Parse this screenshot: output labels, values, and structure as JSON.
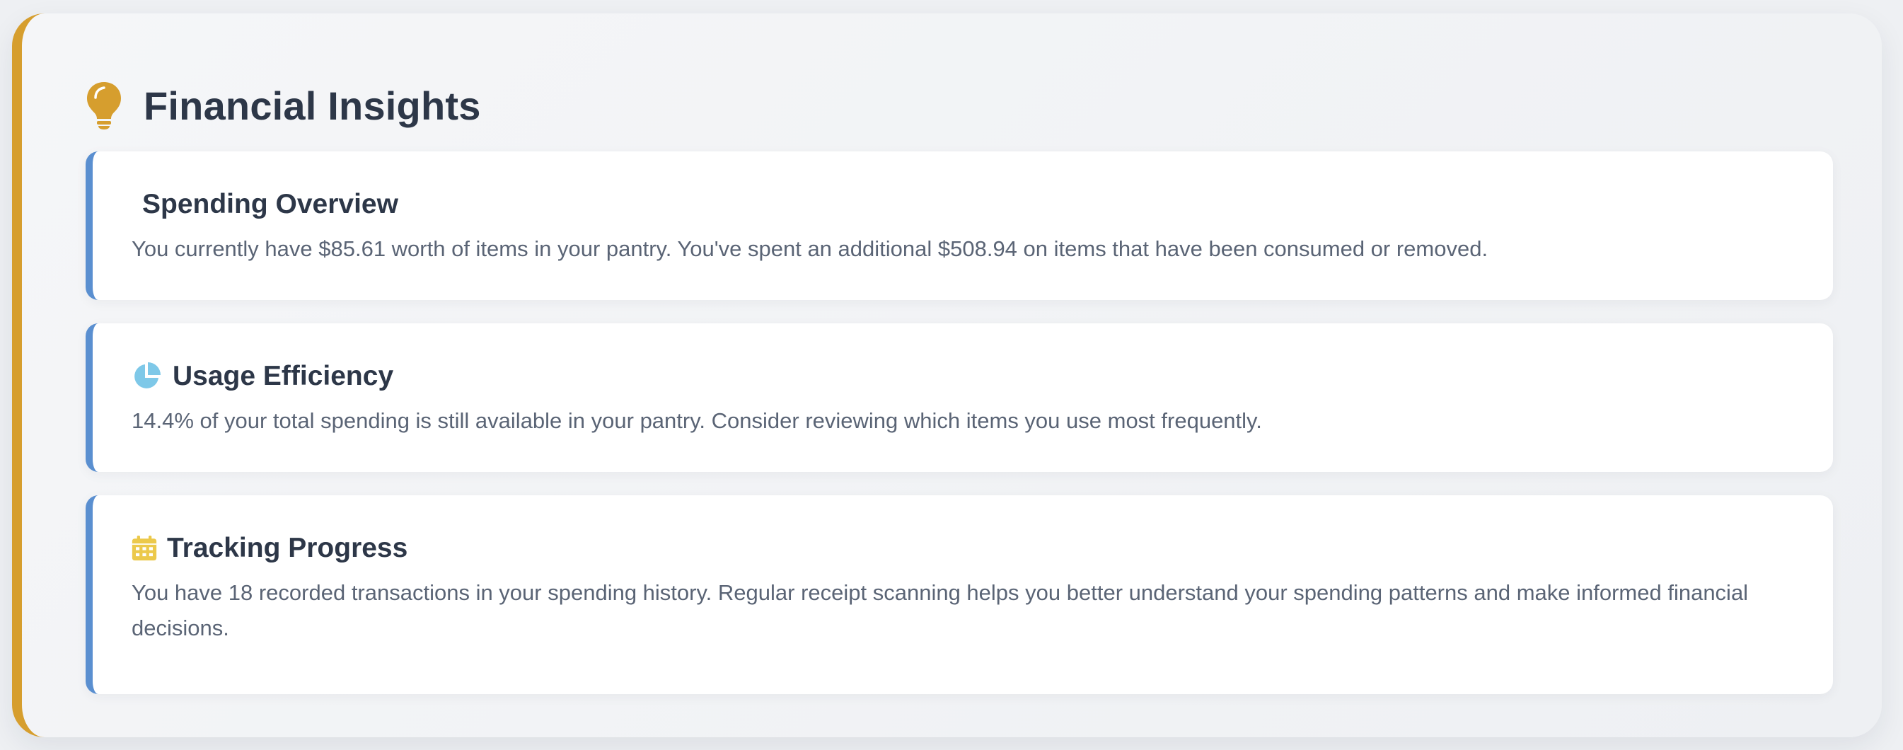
{
  "panel": {
    "title": "Financial Insights",
    "icon": "lightbulb-icon",
    "accent_color": "#d69e2e"
  },
  "cards": [
    {
      "title": "Spending Overview",
      "text": "You currently have $85.61 worth of items in your pantry. You've spent an additional $508.94 on items that have been consumed or removed."
    },
    {
      "title": "Usage Efficiency",
      "icon": "pie-chart-icon",
      "icon_color": "#7ec8e8",
      "text": "14.4% of your total spending is still available in your pantry. Consider reviewing which items you use most frequently."
    },
    {
      "title": "Tracking Progress",
      "icon": "calendar-icon",
      "icon_color": "#ecc94b",
      "text": "You have 18 recorded transactions in your spending history. Regular receipt scanning helps you better understand your spending patterns and make informed financial decisions."
    }
  ],
  "colors": {
    "card_accent": "#5a8fd0",
    "title": "#2d3748",
    "body_text": "#5a6475"
  }
}
